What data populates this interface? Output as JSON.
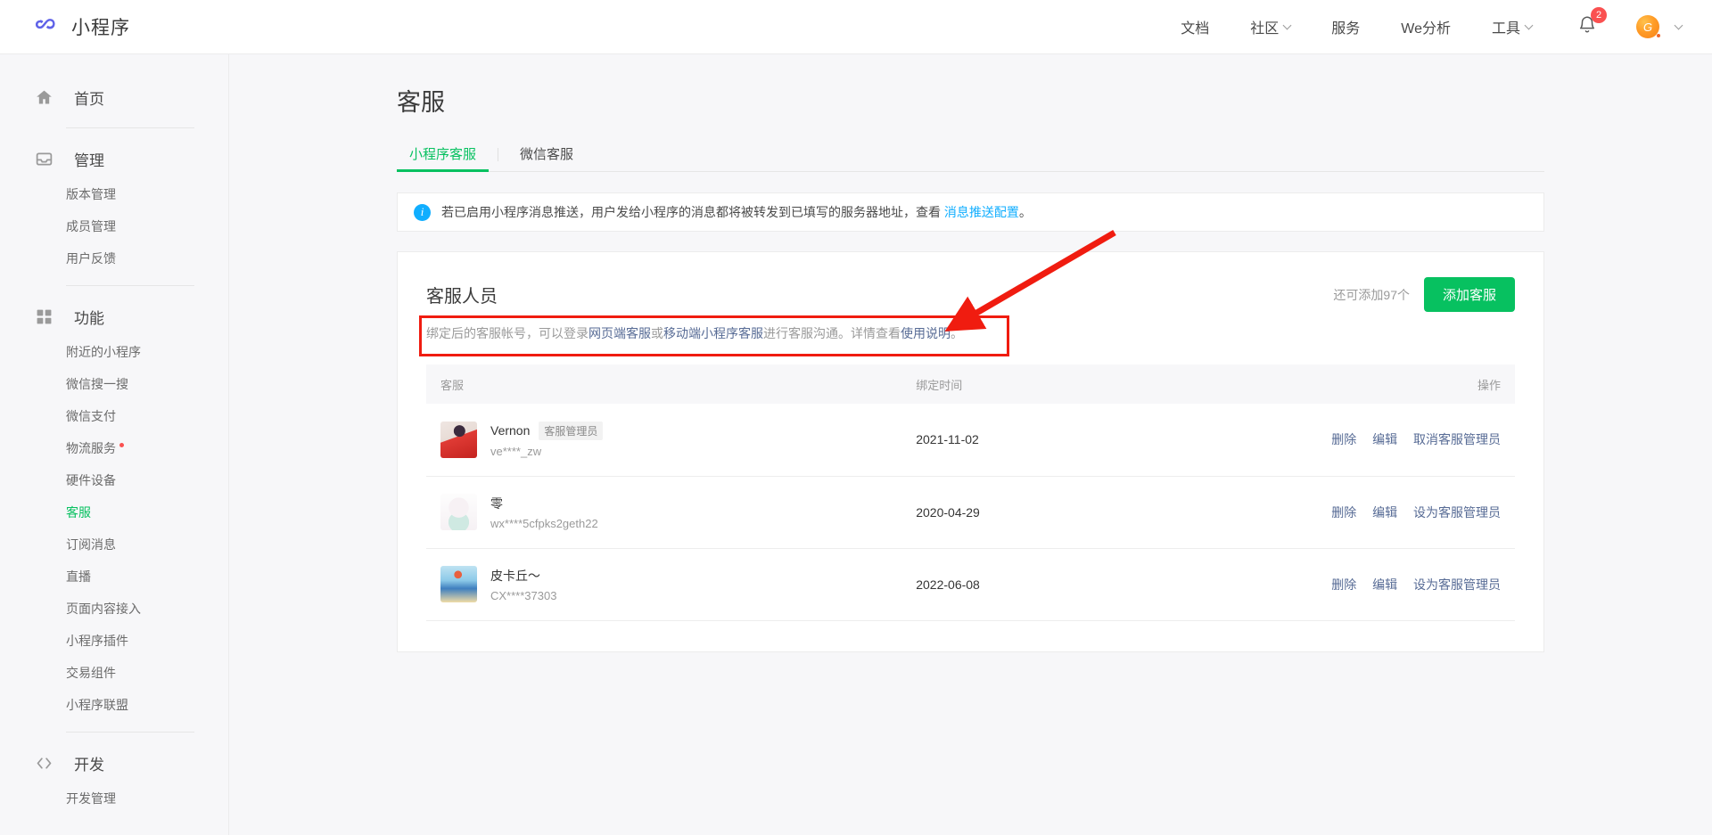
{
  "header": {
    "brand": "小程序",
    "logo_icon": "mini-program-logo-icon",
    "nav": [
      {
        "label": "文档",
        "caret": false
      },
      {
        "label": "社区",
        "caret": true
      },
      {
        "label": "服务",
        "caret": false
      },
      {
        "label": "We分析",
        "caret": false
      },
      {
        "label": "工具",
        "caret": true
      }
    ],
    "bell_icon": "bell-icon",
    "notification_count": "2",
    "avatar_letter": "G"
  },
  "sidebar": {
    "groups": [
      {
        "label": "首页",
        "icon": "home-icon",
        "items": []
      },
      {
        "label": "管理",
        "icon": "inbox-icon",
        "items": [
          {
            "label": "版本管理",
            "active": false,
            "dot": false
          },
          {
            "label": "成员管理",
            "active": false,
            "dot": false
          },
          {
            "label": "用户反馈",
            "active": false,
            "dot": false
          }
        ]
      },
      {
        "label": "功能",
        "icon": "grid-icon",
        "items": [
          {
            "label": "附近的小程序",
            "active": false,
            "dot": false
          },
          {
            "label": "微信搜一搜",
            "active": false,
            "dot": false
          },
          {
            "label": "微信支付",
            "active": false,
            "dot": false
          },
          {
            "label": "物流服务",
            "active": false,
            "dot": true
          },
          {
            "label": "硬件设备",
            "active": false,
            "dot": false
          },
          {
            "label": "客服",
            "active": true,
            "dot": false
          },
          {
            "label": "订阅消息",
            "active": false,
            "dot": false
          },
          {
            "label": "直播",
            "active": false,
            "dot": false
          },
          {
            "label": "页面内容接入",
            "active": false,
            "dot": false
          },
          {
            "label": "小程序插件",
            "active": false,
            "dot": false
          },
          {
            "label": "交易组件",
            "active": false,
            "dot": false
          },
          {
            "label": "小程序联盟",
            "active": false,
            "dot": false
          }
        ]
      },
      {
        "label": "开发",
        "icon": "code-icon",
        "items": [
          {
            "label": "开发管理",
            "active": false,
            "dot": false
          }
        ]
      }
    ]
  },
  "main": {
    "page_title": "客服",
    "tabs": [
      {
        "label": "小程序客服",
        "active": true
      },
      {
        "label": "微信客服",
        "active": false
      }
    ],
    "notice": {
      "icon": "info-icon",
      "text_before": "若已启用小程序消息推送，用户发给小程序的消息都将被转发到已填写的服务器地址，查看 ",
      "link": "消息推送配置",
      "text_after": "。"
    },
    "card": {
      "title": "客服人员",
      "remaining": "还可添加97个",
      "add_button": "添加客服",
      "desc_p1": "绑定后的客服帐号，可以登录",
      "desc_link1": "网页端客服",
      "desc_p2": "或",
      "desc_link2": "移动端小程序客服",
      "desc_p3": "进行客服沟通。详情查看",
      "desc_link3": "使用说明",
      "desc_p4": "。",
      "table": {
        "headers": [
          "客服",
          "绑定时间",
          "操作"
        ],
        "rows": [
          {
            "avatar": "avatar-vernon",
            "nickname": "Vernon",
            "tag": "客服管理员",
            "account": "ve****_zw",
            "bind_time": "2021-11-02",
            "actions": [
              "删除",
              "编辑",
              "取消客服管理员"
            ]
          },
          {
            "avatar": "avatar-ling",
            "nickname": "零",
            "tag": "",
            "account": "wx****5cfpks2geth22",
            "bind_time": "2020-04-29",
            "actions": [
              "删除",
              "编辑",
              "设为客服管理员"
            ]
          },
          {
            "avatar": "avatar-pikachu",
            "nickname": "皮卡丘～",
            "tag": "",
            "account": "CX****37303",
            "bind_time": "2022-06-08",
            "actions": [
              "删除",
              "编辑",
              "设为客服管理员"
            ]
          }
        ]
      }
    }
  },
  "annotations": {
    "highlight_color": "#f01c10",
    "arrow_icon": "red-arrow-icon",
    "box_icon": "red-highlight-box"
  },
  "colors": {
    "brand_green": "#07c160",
    "link_blue": "#576b95",
    "info_blue": "#10aeff",
    "badge_red": "#fa5151",
    "logo_purple": "#5f62e8"
  }
}
